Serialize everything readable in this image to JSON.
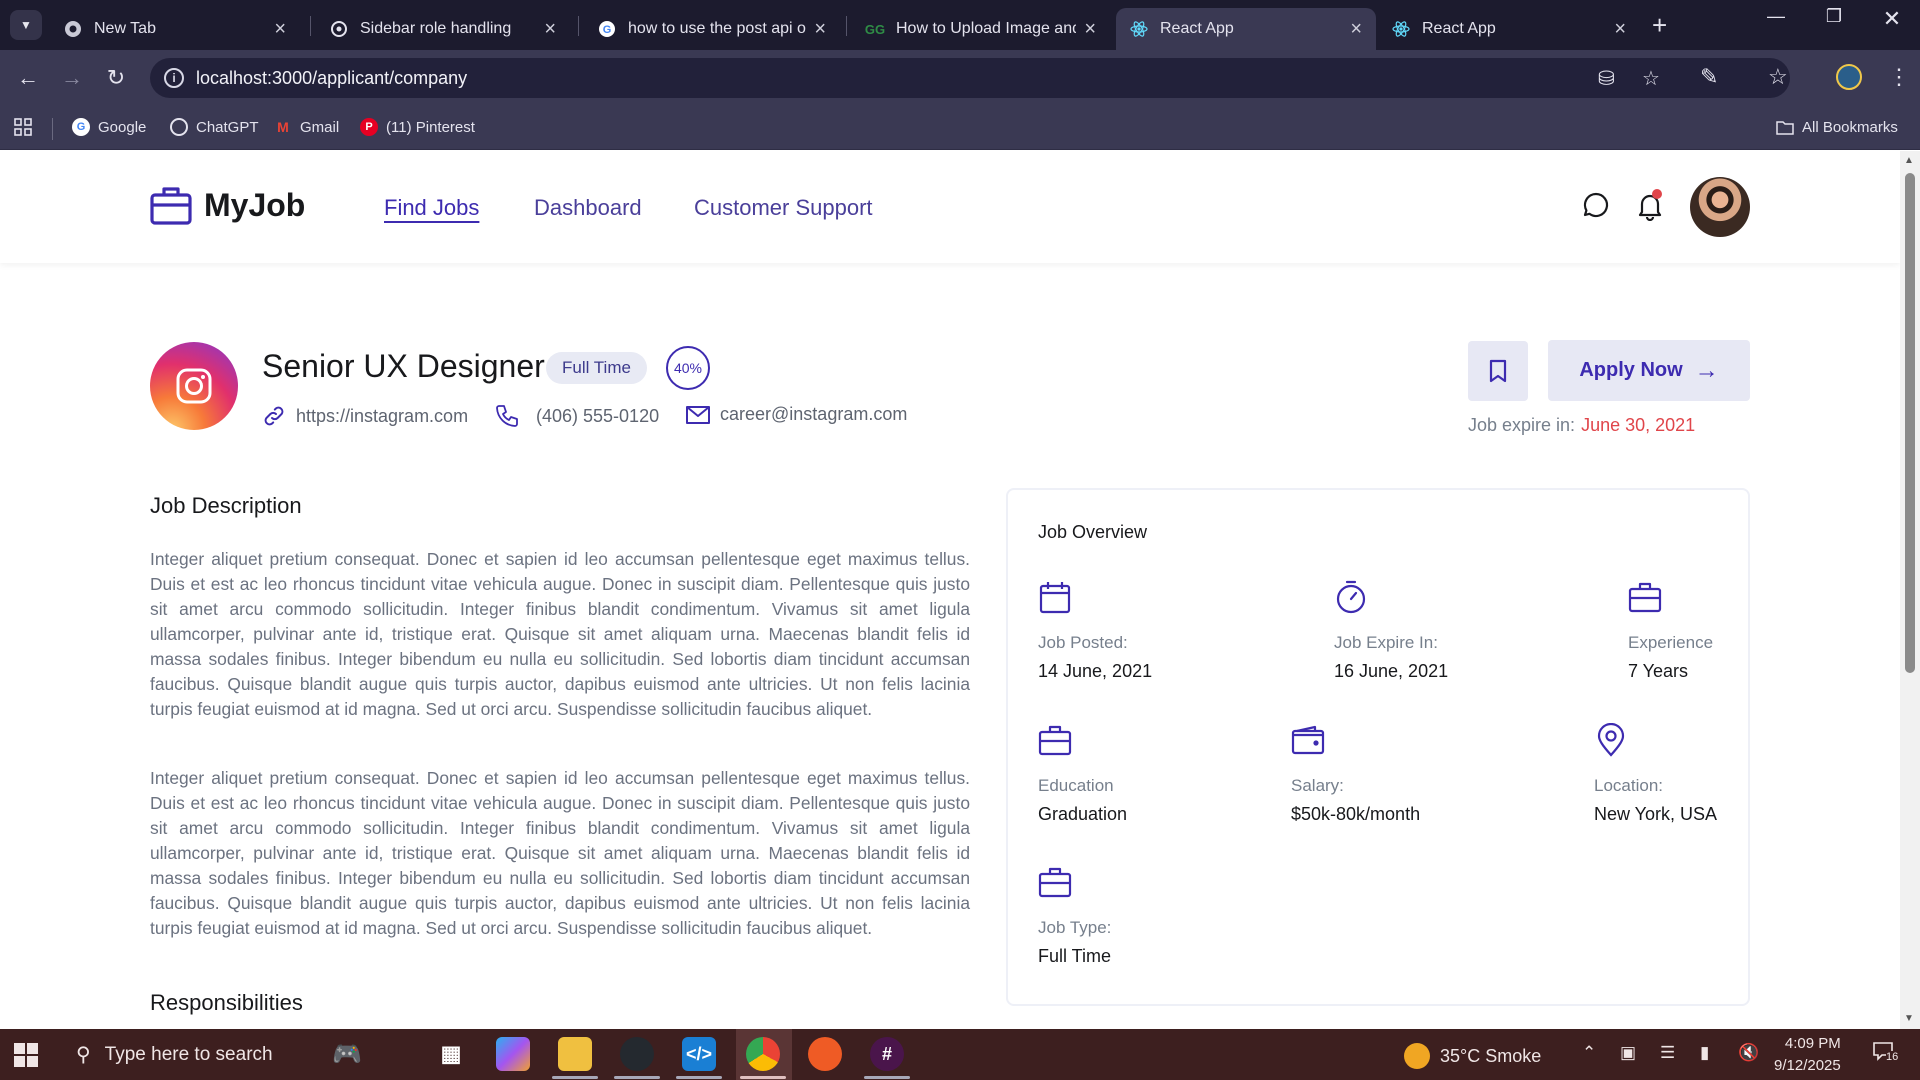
{
  "browser": {
    "tabs": [
      {
        "title": "New Tab",
        "icon": "chrome-icon"
      },
      {
        "title": "Sidebar role handling",
        "icon": "chatgpt-icon"
      },
      {
        "title": "how to use the post api of",
        "icon": "google-icon"
      },
      {
        "title": "How to Upload Image and",
        "icon": "geeksforgeeks-icon"
      },
      {
        "title": "React App",
        "icon": "react-icon"
      },
      {
        "title": "React App",
        "icon": "react-icon"
      }
    ],
    "active_tab_index": 4,
    "url": "localhost:3000/applicant/company",
    "bookmarks": [
      {
        "label": "Google"
      },
      {
        "label": "ChatGPT"
      },
      {
        "label": "Gmail"
      },
      {
        "label": "(11) Pinterest"
      }
    ],
    "all_bookmarks_label": "All Bookmarks"
  },
  "site": {
    "logo_text": "MyJob",
    "nav": [
      {
        "label": "Find Jobs",
        "active": true
      },
      {
        "label": "Dashboard",
        "active": false
      },
      {
        "label": "Customer Support",
        "active": false
      }
    ],
    "accent_color": "#3d2bb0"
  },
  "job": {
    "title": "Senior UX Designer",
    "type_badge": "Full Time",
    "match_percent": "40%",
    "website": "https://instagram.com",
    "phone": "(406) 555-0120",
    "email": "career@instagram.com",
    "apply_label": "Apply Now",
    "expire_label": "Job expire in:",
    "expire_date": "June 30, 2021",
    "description_title": "Job Description",
    "description_paragraphs": [
      "Integer aliquet pretium consequat. Donec et sapien id leo accumsan pellentesque eget maximus tellus. Duis et est ac leo rhoncus tincidunt vitae vehicula augue. Donec in suscipit diam. Pellentesque quis justo sit amet arcu commodo sollicitudin. Integer finibus blandit condimentum. Vivamus sit amet ligula ullamcorper, pulvinar ante id, tristique erat. Quisque sit amet aliquam urna. Maecenas blandit felis id massa sodales finibus. Integer bibendum eu nulla eu sollicitudin. Sed lobortis diam tincidunt accumsan faucibus. Quisque blandit augue quis turpis auctor, dapibus euismod ante ultricies. Ut non felis lacinia turpis feugiat euismod at id magna. Sed ut orci arcu. Suspendisse sollicitudin faucibus aliquet.",
      "Integer aliquet pretium consequat. Donec et sapien id leo accumsan pellentesque eget maximus tellus. Duis et est ac leo rhoncus tincidunt vitae vehicula augue. Donec in suscipit diam. Pellentesque quis justo sit amet arcu commodo sollicitudin. Integer finibus blandit condimentum. Vivamus sit amet ligula ullamcorper, pulvinar ante id, tristique erat. Quisque sit amet aliquam urna. Maecenas blandit felis id massa sodales finibus. Integer bibendum eu nulla eu sollicitudin. Sed lobortis diam tincidunt accumsan faucibus. Quisque blandit augue quis turpis auctor, dapibus euismod ante ultricies. Ut non felis lacinia turpis feugiat euismod at id magna. Sed ut orci arcu. Suspendisse sollicitudin faucibus aliquet."
    ],
    "responsibilities_title": "Responsibilities"
  },
  "overview": {
    "title": "Job Overview",
    "items": [
      {
        "label": "Job Posted:",
        "value": "14 June, 2021",
        "icon": "calendar-icon"
      },
      {
        "label": "Job Expire In:",
        "value": "16 June, 2021",
        "icon": "timer-icon"
      },
      {
        "label": "Experience",
        "value": "7 Years",
        "icon": "briefcase-icon"
      },
      {
        "label": "Education",
        "value": "Graduation",
        "icon": "briefcase-icon"
      },
      {
        "label": "Salary:",
        "value": "$50k-80k/month",
        "icon": "wallet-icon"
      },
      {
        "label": "Location:",
        "value": "New York, USA",
        "icon": "map-pin-icon"
      },
      {
        "label": "Job Type:",
        "value": "Full Time",
        "icon": "briefcase-icon"
      }
    ]
  },
  "taskbar": {
    "search_placeholder": "Type here to search",
    "weather": "35°C  Smoke",
    "time": "4:09 PM",
    "date": "9/12/2025",
    "notification_count": "16"
  }
}
